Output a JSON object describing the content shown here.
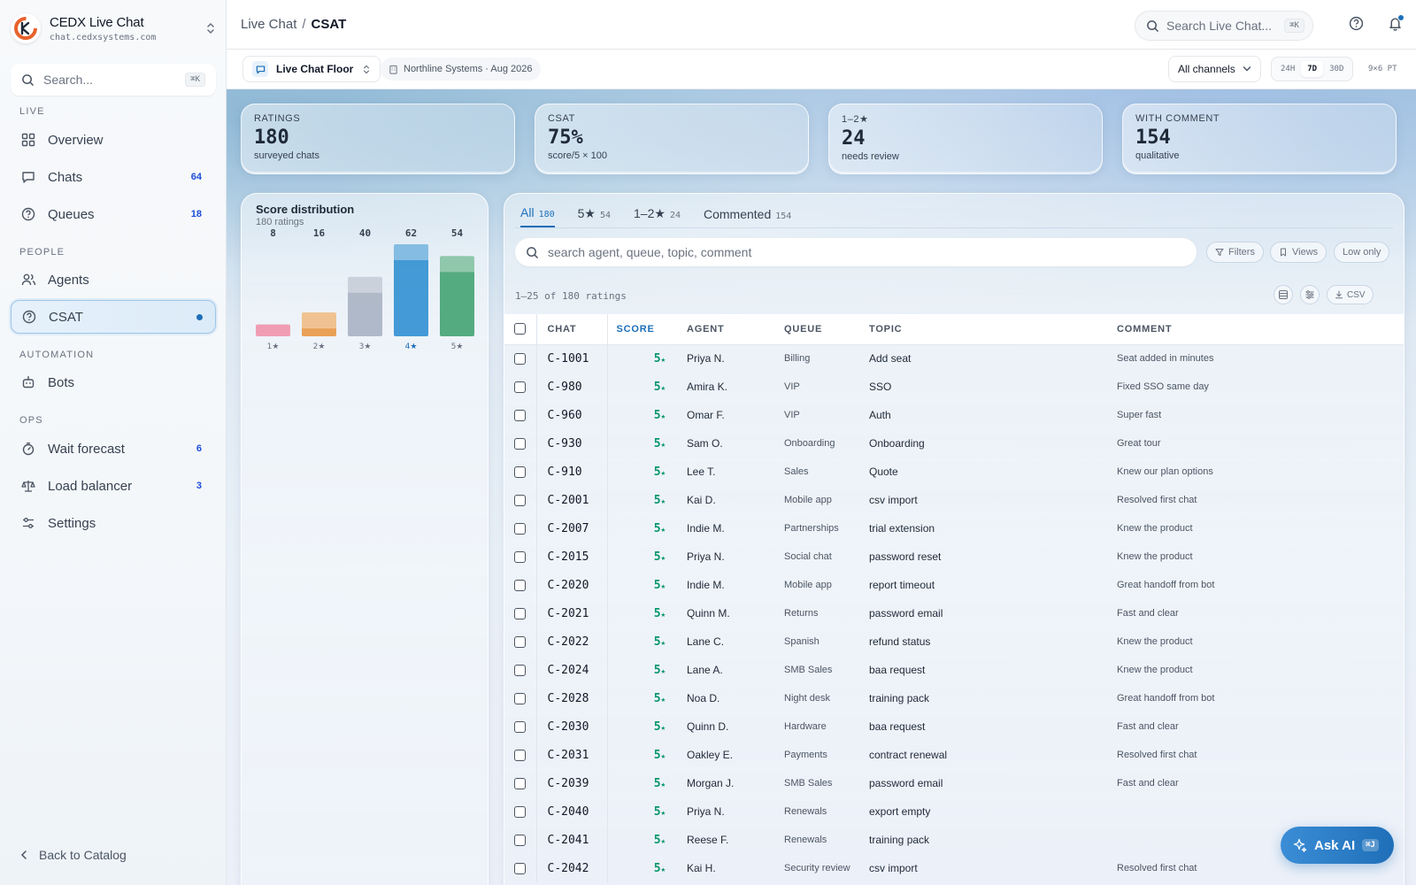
{
  "app": {
    "name": "CEDX Live Chat",
    "url": "chat.cedxsystems.com"
  },
  "sidebar": {
    "search_placeholder": "Search...",
    "search_kbd": "⌘K",
    "sections": {
      "live": "LIVE",
      "people": "PEOPLE",
      "automation": "AUTOMATION",
      "ops": "OPS"
    },
    "items": [
      {
        "label": "Overview",
        "count": "",
        "icon": "grid-icon"
      },
      {
        "label": "Chats",
        "count": "64",
        "icon": "chat-icon"
      },
      {
        "label": "Queues",
        "count": "18",
        "icon": "help-circle-icon"
      },
      {
        "label": "Agents",
        "count": "",
        "icon": "users-icon"
      },
      {
        "label": "CSAT",
        "count": "",
        "icon": "help-circle-icon",
        "active": true
      },
      {
        "label": "Bots",
        "count": "",
        "icon": "bot-icon"
      },
      {
        "label": "Wait forecast",
        "count": "6",
        "icon": "timer-icon"
      },
      {
        "label": "Load balancer",
        "count": "3",
        "icon": "scale-icon"
      },
      {
        "label": "Settings",
        "count": "",
        "icon": "sliders-icon"
      }
    ],
    "back": "Back to Catalog"
  },
  "topbar": {
    "breadcrumb_parent": "Live Chat",
    "breadcrumb_sep": "/",
    "breadcrumb_current": "CSAT",
    "search_placeholder": "Search Live Chat...",
    "search_kbd": "⌘K"
  },
  "subbar": {
    "floor": "Live Chat Floor",
    "org": "Northline Systems · Aug 2026",
    "channel": "All channels",
    "ranges": [
      "24H",
      "7D",
      "30D"
    ],
    "active_range": "7D",
    "grid": "9×6 PT"
  },
  "kpis": [
    {
      "label": "RATINGS",
      "value": "180",
      "sub": "surveyed chats"
    },
    {
      "label": "CSAT",
      "value": "75%",
      "sub": "score/5 × 100"
    },
    {
      "label": "1–2★",
      "value": "24",
      "sub": "needs review"
    },
    {
      "label": "WITH COMMENT",
      "value": "154",
      "sub": "qualitative"
    }
  ],
  "chart_data": {
    "type": "bar",
    "title": "Score distribution",
    "subtitle": "180 ratings",
    "categories": [
      "1★",
      "2★",
      "3★",
      "4★",
      "5★"
    ],
    "values": [
      8,
      16,
      40,
      62,
      54
    ],
    "colors": [
      "#e8557a",
      "#e89540",
      "#a7b1c2",
      "#2b8dd0",
      "#3fa06e"
    ]
  },
  "table_card": {
    "tabs": [
      {
        "label": "All",
        "count": "180",
        "active": true
      },
      {
        "label": "5★",
        "count": "54"
      },
      {
        "label": "1–2★",
        "count": "24"
      },
      {
        "label": "Commented",
        "count": "154"
      }
    ],
    "search_placeholder": "search agent, queue, topic, comment",
    "filters_label": "Filters",
    "views_label": "Views",
    "low_only_label": "Low only",
    "count_text": "1–25 of 180 ratings",
    "csv_label": "CSV",
    "columns": [
      "CHAT",
      "SCORE",
      "AGENT",
      "QUEUE",
      "TOPIC",
      "COMMENT"
    ],
    "rows": [
      {
        "chat": "C-1001",
        "score": "5",
        "agent": "Priya N.",
        "queue": "Billing",
        "topic": "Add seat",
        "comment": "Seat added in minutes"
      },
      {
        "chat": "C-980",
        "score": "5",
        "agent": "Amira K.",
        "queue": "VIP",
        "topic": "SSO",
        "comment": "Fixed SSO same day"
      },
      {
        "chat": "C-960",
        "score": "5",
        "agent": "Omar F.",
        "queue": "VIP",
        "topic": "Auth",
        "comment": "Super fast"
      },
      {
        "chat": "C-930",
        "score": "5",
        "agent": "Sam O.",
        "queue": "Onboarding",
        "topic": "Onboarding",
        "comment": "Great tour"
      },
      {
        "chat": "C-910",
        "score": "5",
        "agent": "Lee T.",
        "queue": "Sales",
        "topic": "Quote",
        "comment": "Knew our plan options"
      },
      {
        "chat": "C-2001",
        "score": "5",
        "agent": "Kai D.",
        "queue": "Mobile app",
        "topic": "csv import",
        "comment": "Resolved first chat"
      },
      {
        "chat": "C-2007",
        "score": "5",
        "agent": "Indie M.",
        "queue": "Partnerships",
        "topic": "trial extension",
        "comment": "Knew the product"
      },
      {
        "chat": "C-2015",
        "score": "5",
        "agent": "Priya N.",
        "queue": "Social chat",
        "topic": "password reset",
        "comment": "Knew the product"
      },
      {
        "chat": "C-2020",
        "score": "5",
        "agent": "Indie M.",
        "queue": "Mobile app",
        "topic": "report timeout",
        "comment": "Great handoff from bot"
      },
      {
        "chat": "C-2021",
        "score": "5",
        "agent": "Quinn M.",
        "queue": "Returns",
        "topic": "password email",
        "comment": "Fast and clear"
      },
      {
        "chat": "C-2022",
        "score": "5",
        "agent": "Lane C.",
        "queue": "Spanish",
        "topic": "refund status",
        "comment": "Knew the product"
      },
      {
        "chat": "C-2024",
        "score": "5",
        "agent": "Lane A.",
        "queue": "SMB Sales",
        "topic": "baa request",
        "comment": "Knew the product"
      },
      {
        "chat": "C-2028",
        "score": "5",
        "agent": "Noa D.",
        "queue": "Night desk",
        "topic": "training pack",
        "comment": "Great handoff from bot"
      },
      {
        "chat": "C-2030",
        "score": "5",
        "agent": "Quinn D.",
        "queue": "Hardware",
        "topic": "baa request",
        "comment": "Fast and clear"
      },
      {
        "chat": "C-2031",
        "score": "5",
        "agent": "Oakley E.",
        "queue": "Payments",
        "topic": "contract renewal",
        "comment": "Resolved first chat"
      },
      {
        "chat": "C-2039",
        "score": "5",
        "agent": "Morgan J.",
        "queue": "SMB Sales",
        "topic": "password email",
        "comment": "Fast and clear"
      },
      {
        "chat": "C-2040",
        "score": "5",
        "agent": "Priya N.",
        "queue": "Renewals",
        "topic": "export empty",
        "comment": ""
      },
      {
        "chat": "C-2041",
        "score": "5",
        "agent": "Reese F.",
        "queue": "Renewals",
        "topic": "training pack",
        "comment": ""
      },
      {
        "chat": "C-2042",
        "score": "5",
        "agent": "Kai H.",
        "queue": "Security review",
        "topic": "csv import",
        "comment": "Resolved first chat"
      }
    ]
  },
  "ask_ai": {
    "label": "Ask AI",
    "kbd": "⌘J"
  }
}
